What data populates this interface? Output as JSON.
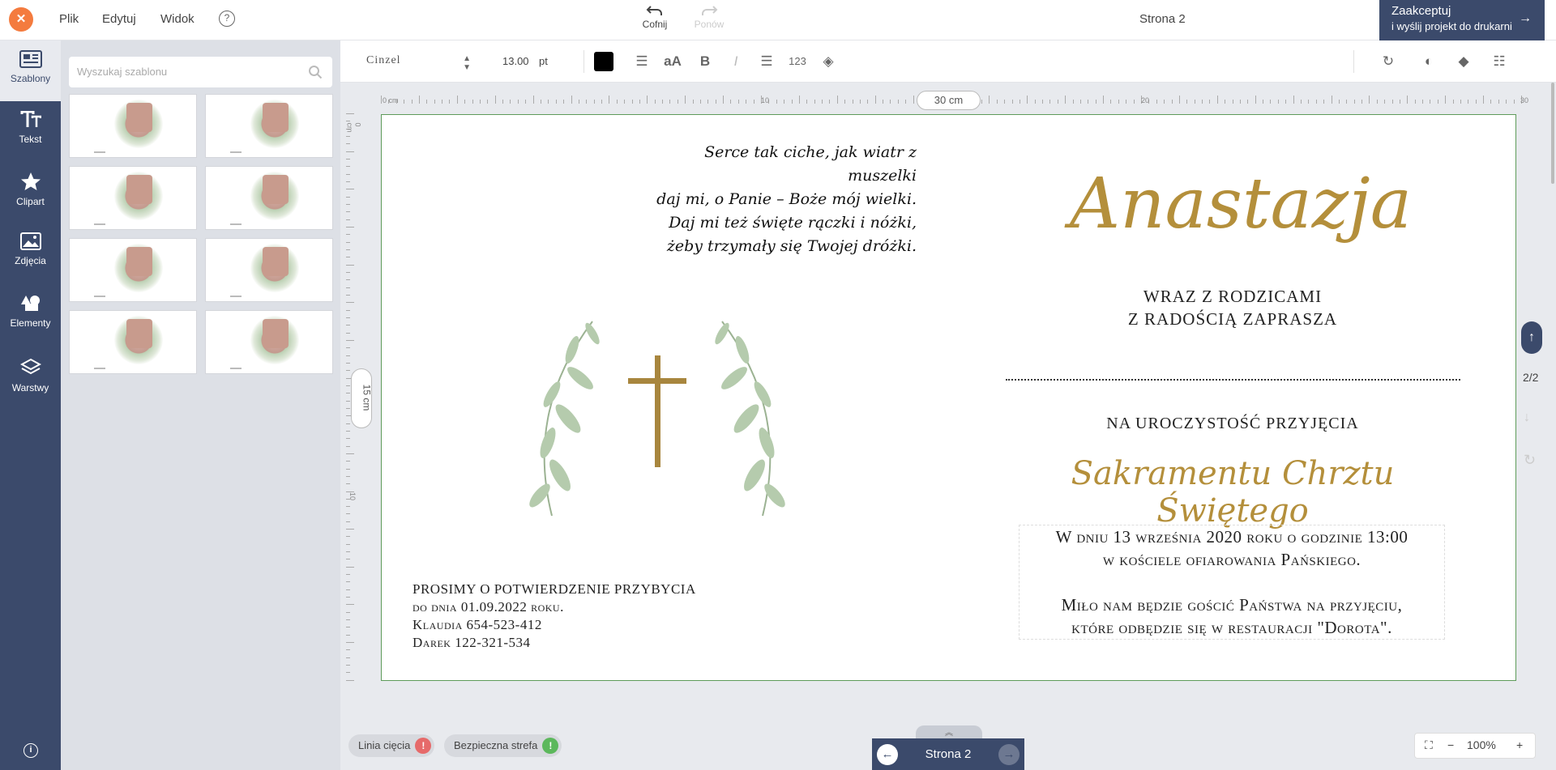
{
  "menu": {
    "file": "Plik",
    "edit": "Edytuj",
    "view": "Widok",
    "help": "?"
  },
  "history": {
    "undo": "Cofnij",
    "redo": "Ponów"
  },
  "page_title": "Strona 2",
  "accept": {
    "line1": "Zaakceptuj",
    "line2": "i wyślij projekt do drukarni"
  },
  "sidebar": {
    "items": [
      {
        "label": "Szablony",
        "icon": "templates-icon"
      },
      {
        "label": "Tekst",
        "icon": "text-icon"
      },
      {
        "label": "Clipart",
        "icon": "star-icon"
      },
      {
        "label": "Zdjęcia",
        "icon": "image-icon"
      },
      {
        "label": "Elementy",
        "icon": "shapes-icon"
      },
      {
        "label": "Warstwy",
        "icon": "layers-icon"
      }
    ]
  },
  "templates": {
    "search_placeholder": "Wyszukaj szablonu",
    "count": 8
  },
  "toolbar": {
    "font": "Cinzel",
    "size": "13.00",
    "unit": "pt",
    "color": "#000000"
  },
  "ruler": {
    "top_labels": [
      "0 cm",
      "10",
      "20",
      "30"
    ],
    "left_labels": [
      "0 cm",
      "10"
    ],
    "width_badge": "30 cm",
    "height_badge": "15 cm"
  },
  "card": {
    "poem": [
      "Serce tak ciche, jak wiatr z muszelki",
      "daj mi, o Panie – Boże mój wielki.",
      "Daj mi też święte rączki i nóżki,",
      "żeby trzymały się Twojej dróżki."
    ],
    "name": "Anastazja",
    "with_parents": [
      "wraz z rodzicami",
      "z radością zaprasza"
    ],
    "ceremony": "na uroczystość przyjęcia",
    "sacrament": "Sakramentu Chrztu Świętego",
    "details": [
      "W dniu 13 września 2020 roku o godzinie 13:00",
      "w kościele ofiarowania Pańskiego.",
      "Miło nam będzie gościć Państwa na przyjęciu,",
      "które odbędzie się w restauracji \"Dorota\"."
    ],
    "rsvp": [
      "Prosimy o potwierdzenie przybycia",
      "do dnia 01.09.2022 roku.",
      "Klaudia 654-523-412",
      "Darek 122-321-534"
    ],
    "accent_color": "#b48f3b"
  },
  "pagination": {
    "count": "2/2",
    "current": "Strona 2"
  },
  "bottom": {
    "cut_line": "Linia cięcia",
    "safe_zone": "Bezpieczna strefa",
    "zoom": "100%"
  },
  "colors": {
    "nav_bg": "#3b4a6b",
    "close": "#f47b3e",
    "cut": "#e66a6a",
    "safe": "#5cb85c"
  }
}
